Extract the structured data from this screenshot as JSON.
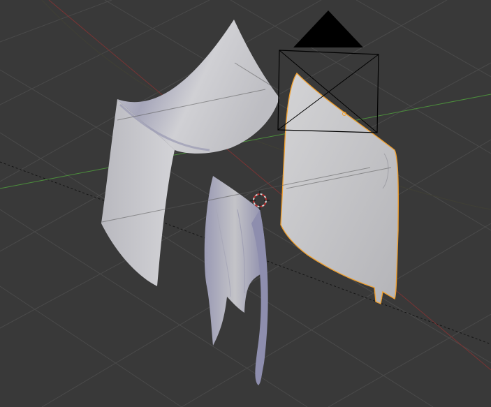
{
  "viewport": {
    "background": "#393939",
    "grid_color": "#4a4a4a",
    "x_axis_color": "#8a3a3a",
    "y_axis_color": "#4c8f3c",
    "selection_outline_color": "#f0a030",
    "cloth_color": "#c8c8cc",
    "objects": [
      {
        "name": "cloth-arch",
        "selected": false
      },
      {
        "name": "cloth-panel",
        "selected": true
      },
      {
        "name": "cloth-drape",
        "selected": false
      },
      {
        "name": "camera",
        "selected": false
      },
      {
        "name": "3d-cursor",
        "selected": false
      }
    ]
  }
}
